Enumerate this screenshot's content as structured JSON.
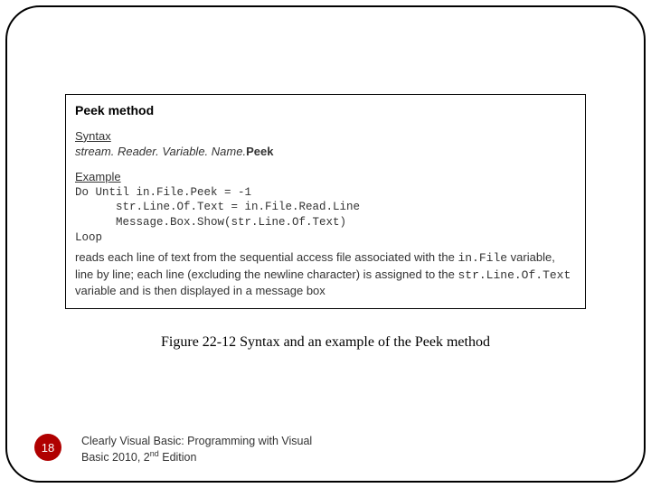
{
  "box": {
    "title": "Peek method",
    "syntax_label": "Syntax",
    "syntax_var": "stream. Reader. Variable. Name",
    "syntax_dot": ".",
    "syntax_method": "Peek",
    "example_label": "Example",
    "code_line1": "Do Until in.File.Peek = -1",
    "code_line2": "      str.Line.Of.Text = in.File.Read.Line",
    "code_line3": "      Message.Box.Show(str.Line.Of.Text)",
    "code_line4": "Loop",
    "desc_part1": "reads each line of text from the sequential access file associated with the ",
    "desc_mono1": "in.File",
    "desc_part2": " variable, line by line; each line (excluding the newline character) is assigned to the ",
    "desc_mono2": "str.Line.Of.Text",
    "desc_part3": " variable and is then displayed in a message box"
  },
  "caption": "Figure 22-12 Syntax and an example of the Peek method",
  "page_number": "18",
  "footer_line1": "Clearly Visual Basic: Programming with Visual",
  "footer_line2a": "Basic 2010, 2",
  "footer_sup": "nd",
  "footer_line2b": " Edition"
}
